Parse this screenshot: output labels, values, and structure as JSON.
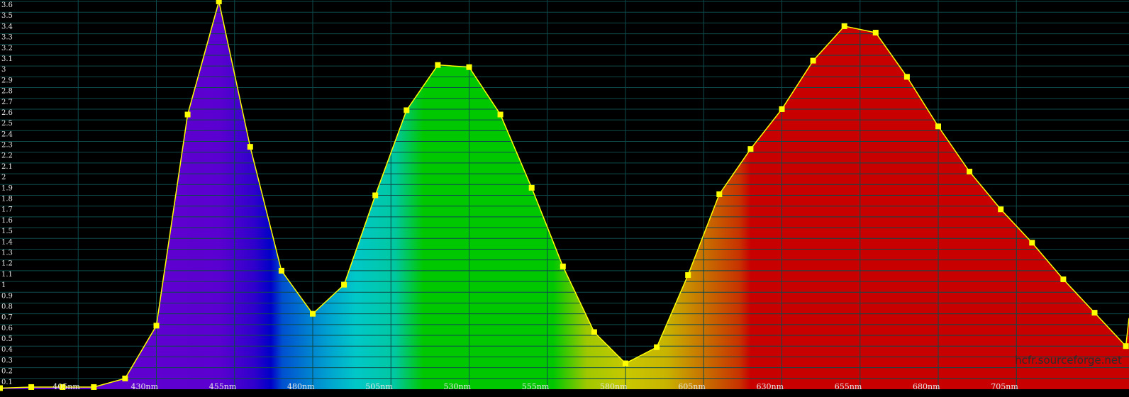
{
  "chart_data": {
    "type": "area",
    "title": "",
    "xlabel": "",
    "ylabel": "",
    "xlim": [
      380,
      741
    ],
    "ylim": [
      0,
      3.6
    ],
    "grid": true,
    "x_tick_labels": [
      "405nm",
      "430nm",
      "455nm",
      "480nm",
      "505nm",
      "530nm",
      "555nm",
      "580nm",
      "605nm",
      "630nm",
      "655nm",
      "680nm",
      "705nm"
    ],
    "x_tick_values": [
      405,
      430,
      455,
      480,
      505,
      530,
      555,
      580,
      605,
      630,
      655,
      680,
      705
    ],
    "y_tick_labels": [
      "0.1",
      "0.2",
      "0.3",
      "0.4",
      "0.5",
      "0.6",
      "0.7",
      "0.8",
      "0.9",
      "1",
      "1.1",
      "1.2",
      "1.3",
      "1.4",
      "1.5",
      "1.6",
      "1.7",
      "1.8",
      "1.9",
      "2",
      "2.1",
      "2.2",
      "2.3",
      "2.4",
      "2.5",
      "2.6",
      "2.7",
      "2.8",
      "2.9",
      "3",
      "3.1",
      "3.2",
      "3.3",
      "3.4",
      "3.5",
      "3.6"
    ],
    "y_tick_values": [
      0.1,
      0.2,
      0.3,
      0.4,
      0.5,
      0.6,
      0.7,
      0.8,
      0.9,
      1,
      1.1,
      1.2,
      1.3,
      1.4,
      1.5,
      1.6,
      1.7,
      1.8,
      1.9,
      2,
      2.1,
      2.2,
      2.3,
      2.4,
      2.5,
      2.6,
      2.7,
      2.8,
      2.9,
      3,
      3.1,
      3.2,
      3.3,
      3.4,
      3.5,
      3.6
    ],
    "x": [
      380,
      390,
      400,
      410,
      420,
      430,
      440,
      450,
      460,
      470,
      480,
      490,
      500,
      510,
      520,
      530,
      540,
      550,
      560,
      570,
      580,
      590,
      600,
      610,
      620,
      630,
      640,
      650,
      660,
      670,
      680,
      690,
      700,
      710,
      720,
      730,
      740
    ],
    "values": [
      0.01,
      0.02,
      0.02,
      0.02,
      0.1,
      0.59,
      2.55,
      3.6,
      2.25,
      1.1,
      0.7,
      0.97,
      1.8,
      2.59,
      3.01,
      2.99,
      2.55,
      1.87,
      1.14,
      0.53,
      0.24,
      0.39,
      1.06,
      1.81,
      2.23,
      2.6,
      3.05,
      3.37,
      3.31,
      2.9,
      2.44,
      2.02,
      1.67,
      1.36,
      1.02,
      0.71,
      0.4
    ],
    "line_color": "#ffff00",
    "marker_color": "#ffff00",
    "grid_color": "#0e4a4a",
    "background": "#000000",
    "watermark": "hcfr.sourceforge.net"
  }
}
